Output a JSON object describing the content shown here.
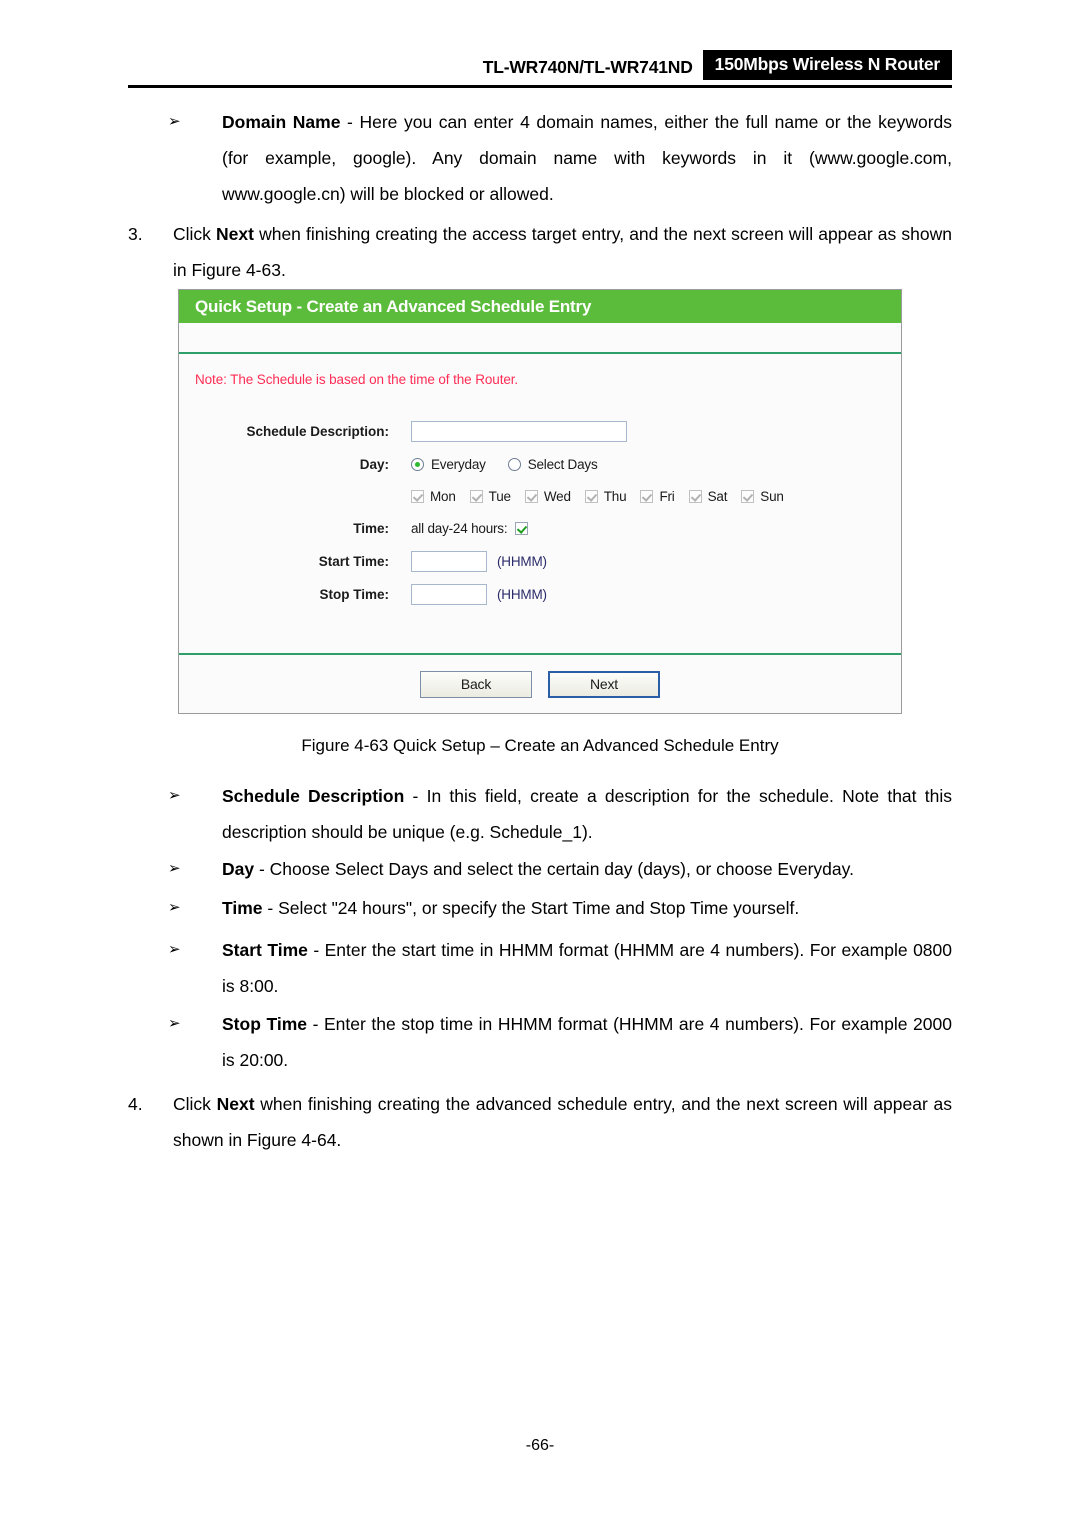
{
  "header": {
    "model": "TL-WR740N/TL-WR741ND",
    "badge": "150Mbps Wireless N Router"
  },
  "intro_bullet": {
    "marker": "➢",
    "term": "Domain Name",
    "text": " - Here you can enter 4 domain names, either the full name or the keywords (for example, google). Any domain name with keywords in it (www.google.com, www.google.cn) will be blocked or allowed."
  },
  "step3": {
    "number": "3.",
    "text_before": "Click ",
    "bold": "Next",
    "text_after": " when finishing creating the access target entry, and the next screen will appear as shown in Figure 4-63."
  },
  "router_ui": {
    "title": "Quick Setup - Create an Advanced Schedule Entry",
    "note": "Note: The Schedule is based on the time of the Router.",
    "fields": {
      "schedule_description_label": "Schedule Description:",
      "schedule_description_value": "",
      "day_label": "Day:",
      "radio_everyday": "Everyday",
      "radio_select_days": "Select Days",
      "radio_selected": "Everyday",
      "days": [
        {
          "label": "Mon",
          "checked": true,
          "disabled": true
        },
        {
          "label": "Tue",
          "checked": true,
          "disabled": true
        },
        {
          "label": "Wed",
          "checked": true,
          "disabled": true
        },
        {
          "label": "Thu",
          "checked": true,
          "disabled": true
        },
        {
          "label": "Fri",
          "checked": true,
          "disabled": true
        },
        {
          "label": "Sat",
          "checked": true,
          "disabled": true
        },
        {
          "label": "Sun",
          "checked": true,
          "disabled": true
        }
      ],
      "time_label": "Time:",
      "all_day_label": "all day-24 hours:",
      "all_day_checked": true,
      "start_time_label": "Start Time:",
      "start_time_value": "",
      "start_time_hint": "(HHMM)",
      "stop_time_label": "Stop Time:",
      "stop_time_value": "",
      "stop_time_hint": "(HHMM)"
    },
    "buttons": {
      "back": "Back",
      "next": "Next"
    },
    "colors": {
      "header_green": "#5bbc3c",
      "separator_green": "#2e9e6b",
      "note_red": "#ff2d55",
      "focus_blue": "#2a5fa8"
    }
  },
  "figure_caption": "Figure 4-63    Quick Setup – Create an Advanced Schedule Entry",
  "bullets": [
    {
      "marker": "➢",
      "term": "Schedule Description",
      "text": " - In this field, create a description for the schedule. Note that this description should be unique (e.g. Schedule_1)."
    },
    {
      "marker": "➢",
      "term": "Day",
      "text": " - Choose Select Days and select the certain day (days), or choose Everyday."
    },
    {
      "marker": "➢",
      "term": "Time",
      "text": " - Select \"24 hours\", or specify the Start Time and Stop Time yourself."
    },
    {
      "marker": "➢",
      "term": "Start Time",
      "text": " - Enter the start time in HHMM format (HHMM are 4 numbers). For example 0800 is 8:00."
    },
    {
      "marker": "➢",
      "term": "Stop Time",
      "text": " - Enter the stop time in HHMM format (HHMM are 4 numbers). For example 2000 is 20:00."
    }
  ],
  "step4": {
    "number": "4.",
    "text_before": "Click ",
    "bold": "Next",
    "text_after": " when finishing creating the advanced schedule entry, and the next screen will appear as shown in Figure 4-64."
  },
  "page_number": "-66-"
}
